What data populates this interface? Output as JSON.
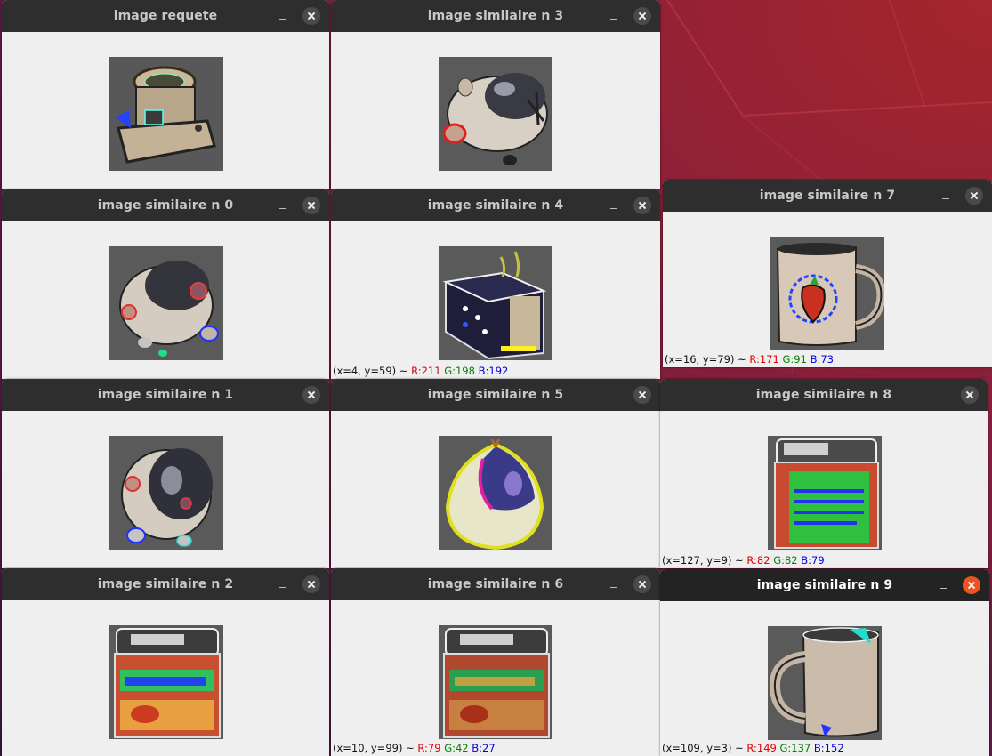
{
  "colors": {
    "titlebar": "#2e2e2e",
    "titlebar_active": "#232323",
    "close_active": "#e95420",
    "window_bg": "#efefef",
    "red": "#e00000",
    "green": "#008000",
    "blue": "#0000e0"
  },
  "windows": {
    "requete": {
      "title": "image requete",
      "subject": "tea-cup-object"
    },
    "n0": {
      "title": "image similaire n 0",
      "subject": "piggy-bank"
    },
    "n1": {
      "title": "image similaire n 1",
      "subject": "piggy-bank"
    },
    "n2": {
      "title": "image similaire n 2",
      "subject": "cinnamon-tin"
    },
    "n3": {
      "title": "image similaire n 3",
      "subject": "piggy-bank"
    },
    "n4": {
      "title": "image similaire n 4",
      "subject": "toaster",
      "status": {
        "coords": "(x=4, y=59) ~ ",
        "r": "R:211",
        "g": "G:198",
        "b": "B:192"
      }
    },
    "n5": {
      "title": "image similaire n 5",
      "subject": "onion"
    },
    "n6": {
      "title": "image similaire n 6",
      "subject": "cinnamon-tin",
      "status": {
        "coords": "(x=10, y=99) ~ ",
        "r": "R:79",
        "g": "G:42",
        "b": "B:27"
      }
    },
    "n7": {
      "title": "image similaire n 7",
      "subject": "strawberry-mug",
      "status": {
        "coords": "(x=16, y=79) ~ ",
        "r": "R:171",
        "g": "G:91",
        "b": "B:73"
      }
    },
    "n8": {
      "title": "image similaire n 8",
      "subject": "cinnamon-tin",
      "status": {
        "coords": "(x=127, y=9) ~ ",
        "r": "R:82",
        "g": "G:82",
        "b": "B:79"
      }
    },
    "n9": {
      "title": "image similaire n 9",
      "subject": "mug",
      "active": true,
      "status": {
        "coords": "(x=109, y=3) ~ ",
        "r": "R:149",
        "g": "G:137",
        "b": "B:152"
      }
    }
  }
}
